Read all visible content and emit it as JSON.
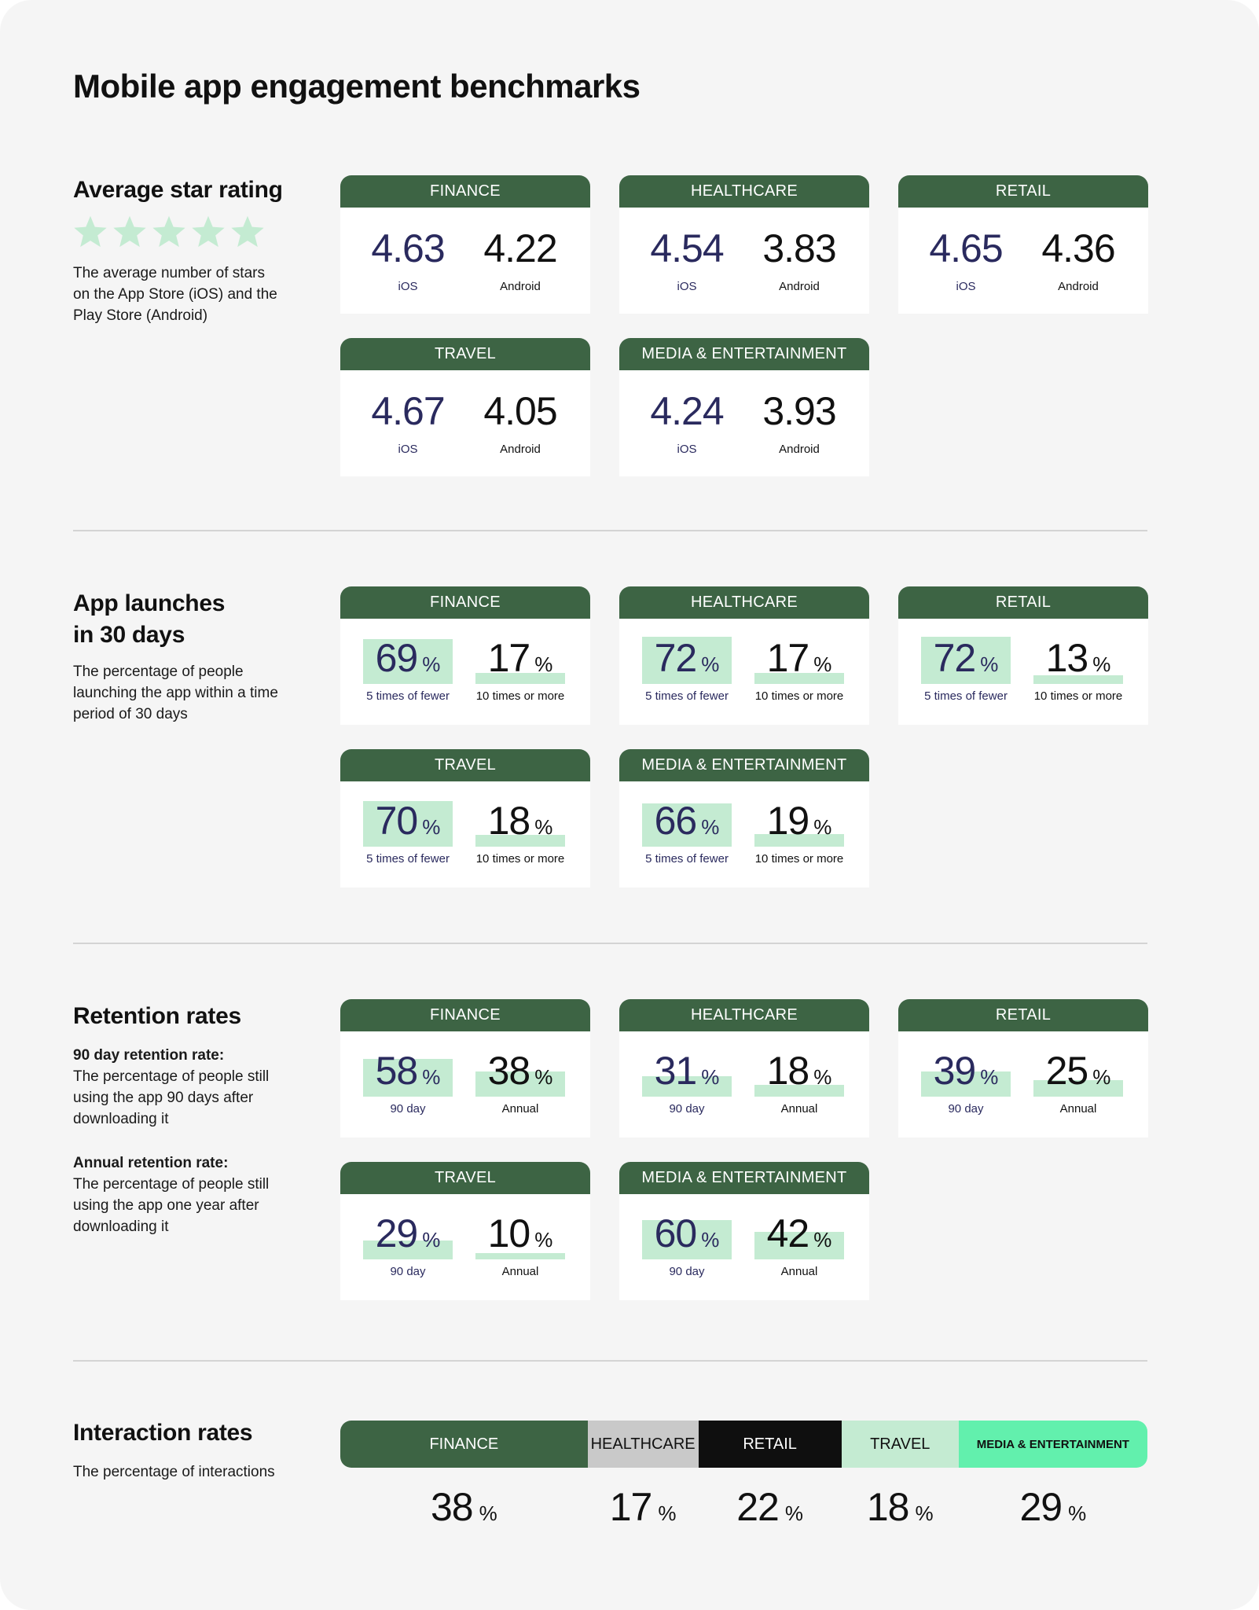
{
  "page": {
    "title": "Mobile app engagement benchmarks"
  },
  "colors": {
    "header_green": "#3d6444",
    "bar_mint": "#c4ebd2",
    "ios_text": "#2a2a5e",
    "interaction_finance": "#3d6444",
    "interaction_healthcare": "#c9c9c9",
    "interaction_retail": "#0f0f0f",
    "interaction_travel": "#c4ebd2",
    "interaction_media": "#62f0ad"
  },
  "sections": {
    "rating": {
      "title": "Average star rating",
      "description": "The average number of stars on the App Store (iOS) and the Play Store (Android)",
      "stars_icon": "star-icon",
      "star_count": 5
    },
    "launches": {
      "title_line1": "App launches",
      "title_line2": "in 30 days",
      "description": "The percentage of people launching the app within a time period of 30 days"
    },
    "retention": {
      "title": "Retention rates",
      "def1_label": "90 day retention rate:",
      "def1_text": "The percentage of people still using the app 90 days after downloading it",
      "def2_label": "Annual retention rate:",
      "def2_text": "The percentage of people still using the app one year after downloading it"
    },
    "interaction": {
      "title": "Interaction rates",
      "description": "The percentage of interactions"
    }
  },
  "chart_data": [
    {
      "type": "table",
      "title": "Average star rating",
      "categories": [
        "FINANCE",
        "HEALTHCARE",
        "RETAIL",
        "TRAVEL",
        "MEDIA & ENTERTAINMENT"
      ],
      "series": [
        {
          "name": "iOS",
          "values": [
            4.63,
            4.54,
            4.65,
            4.67,
            4.24
          ]
        },
        {
          "name": "Android",
          "values": [
            4.22,
            3.83,
            4.36,
            4.05,
            3.93
          ]
        }
      ]
    },
    {
      "type": "bar",
      "title": "App launches in 30 days",
      "unit": "%",
      "ylim": [
        0,
        100
      ],
      "categories": [
        "FINANCE",
        "HEALTHCARE",
        "RETAIL",
        "TRAVEL",
        "MEDIA & ENTERTAINMENT"
      ],
      "series": [
        {
          "name": "5 times of fewer",
          "values": [
            69,
            72,
            72,
            70,
            66
          ]
        },
        {
          "name": "10 times or more",
          "values": [
            17,
            17,
            13,
            18,
            19
          ]
        }
      ]
    },
    {
      "type": "bar",
      "title": "Retention rates",
      "unit": "%",
      "ylim": [
        0,
        100
      ],
      "categories": [
        "FINANCE",
        "HEALTHCARE",
        "RETAIL",
        "TRAVEL",
        "MEDIA & ENTERTAINMENT"
      ],
      "series": [
        {
          "name": "90 day",
          "values": [
            58,
            31,
            39,
            29,
            60
          ]
        },
        {
          "name": "Annual",
          "values": [
            38,
            18,
            25,
            10,
            42
          ]
        }
      ]
    },
    {
      "type": "bar",
      "title": "Interaction rates",
      "subtitle": "The percentage of interactions",
      "unit": "%",
      "orientation": "stacked-horizontal",
      "categories": [
        "FINANCE",
        "HEALTHCARE",
        "RETAIL",
        "TRAVEL",
        "MEDIA & ENTERTAINMENT"
      ],
      "values": [
        38,
        17,
        22,
        18,
        29
      ]
    }
  ],
  "pct_symbol": "%"
}
